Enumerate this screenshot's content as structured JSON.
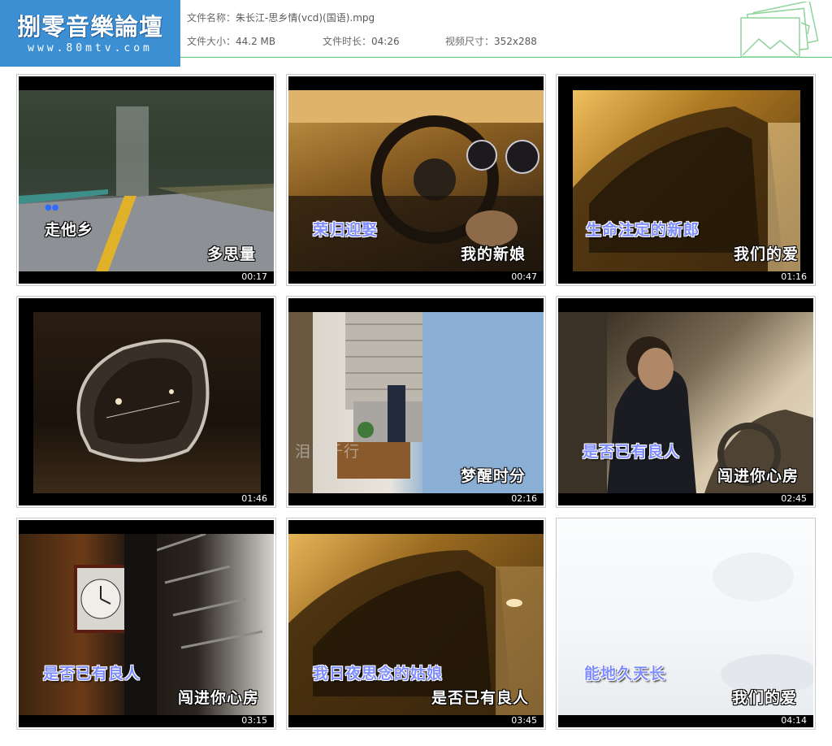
{
  "header": {
    "logo_title": "捌零音樂論壇",
    "logo_url": "www.80mtv.com",
    "file_name_label": "文件名称：",
    "file_name": "朱长江-思乡情(vcd)(国语).mpg",
    "file_size_label": "文件大小：",
    "file_size": "44.2 MB",
    "duration_label": "文件时长：",
    "duration": "04:26",
    "resolution_label": "视频尺寸：",
    "resolution": "352x288"
  },
  "thumbnails": [
    {
      "time": "00:17",
      "lyric_top": "走他乡",
      "lyric_bottom": "多思量",
      "dots": "●●"
    },
    {
      "time": "00:47",
      "lyric_top": "荣归迎娶",
      "lyric_bottom": "我的新娘"
    },
    {
      "time": "01:16",
      "lyric_top": "生命注定的新郎",
      "lyric_bottom": "我们的爱"
    },
    {
      "time": "01:46"
    },
    {
      "time": "02:16",
      "lyric_top": "泪已千行",
      "lyric_bottom": "梦醒时分"
    },
    {
      "time": "02:45",
      "lyric_top": "是否已有良人",
      "lyric_bottom": "闯进你心房"
    },
    {
      "time": "03:15",
      "lyric_top": "是否已有良人",
      "lyric_bottom": "闯进你心房"
    },
    {
      "time": "03:45",
      "lyric_top": "我日夜思念的姑娘",
      "lyric_bottom": "是否已有良人"
    },
    {
      "time": "04:14",
      "lyric_top": "能地久天长",
      "lyric_bottom": "我们的爱"
    }
  ],
  "colors": {
    "logo_bg": "#3d8fd4",
    "divider": "#5fc36a",
    "lyric_blue": "#7f8dff"
  }
}
